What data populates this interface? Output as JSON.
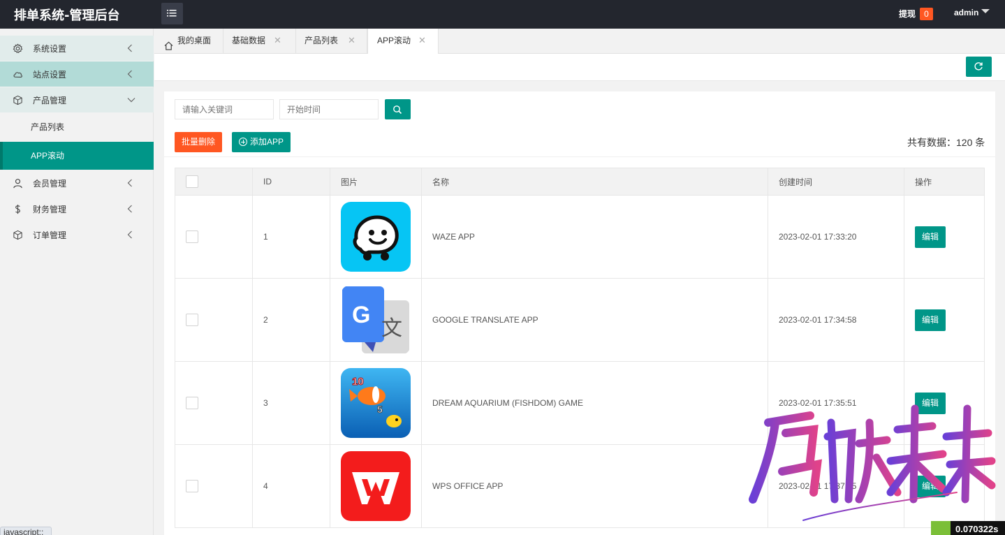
{
  "header": {
    "app_title": "排单系统-管理后台",
    "withdraw_label": "提现",
    "withdraw_count": "0",
    "user_name": "admin"
  },
  "sidebar": {
    "items": [
      {
        "label": "系统设置",
        "icon": "gear-icon"
      },
      {
        "label": "站点设置",
        "icon": "cloud-icon"
      },
      {
        "label": "产品管理",
        "icon": "package-icon"
      },
      {
        "label": "会员管理",
        "icon": "user-icon"
      },
      {
        "label": "财务管理",
        "icon": "dollar-icon"
      },
      {
        "label": "订单管理",
        "icon": "package-icon"
      }
    ],
    "sub_items": [
      {
        "label": "产品列表"
      },
      {
        "label": "APP滚动"
      }
    ]
  },
  "tabs": [
    {
      "label": "我的桌面",
      "close": ""
    },
    {
      "label": "基础数据",
      "close": "✕"
    },
    {
      "label": "产品列表",
      "close": "✕"
    },
    {
      "label": "APP滚动",
      "close": "✕"
    }
  ],
  "toolbar": {
    "keyword_placeholder": "请输入关键词",
    "start_time_placeholder": "开始时间",
    "batch_delete_label": "批量删除",
    "add_app_label": "添加APP",
    "total_text": "共有数据：120 条"
  },
  "table": {
    "columns": [
      "",
      "ID",
      "图片",
      "名称",
      "创建时间",
      "操作"
    ],
    "rows": [
      {
        "id": "1",
        "name": "WAZE APP",
        "created": "2023-02-01 17:33:20",
        "action": "编辑",
        "icon": "waze-icon"
      },
      {
        "id": "2",
        "name": "GOOGLE TRANSLATE APP",
        "created": "2023-02-01 17:34:58",
        "action": "编辑",
        "icon": "google-translate-icon"
      },
      {
        "id": "3",
        "name": "DREAM AQUARIUM (FISHDOM) GAME",
        "created": "2023-02-01 17:35:51",
        "action": "编辑",
        "icon": "fishdom-icon"
      },
      {
        "id": "4",
        "name": "WPS OFFICE APP",
        "created": "2023-02-01 17:37:25",
        "action": "编辑",
        "icon": "wps-office-icon"
      }
    ]
  },
  "status_bar": {
    "link_text": "javascript:;",
    "timer_text": "0.070322s"
  },
  "colors": {
    "accent": "#009688",
    "danger": "#ff5722",
    "header_bg": "#23262e"
  }
}
